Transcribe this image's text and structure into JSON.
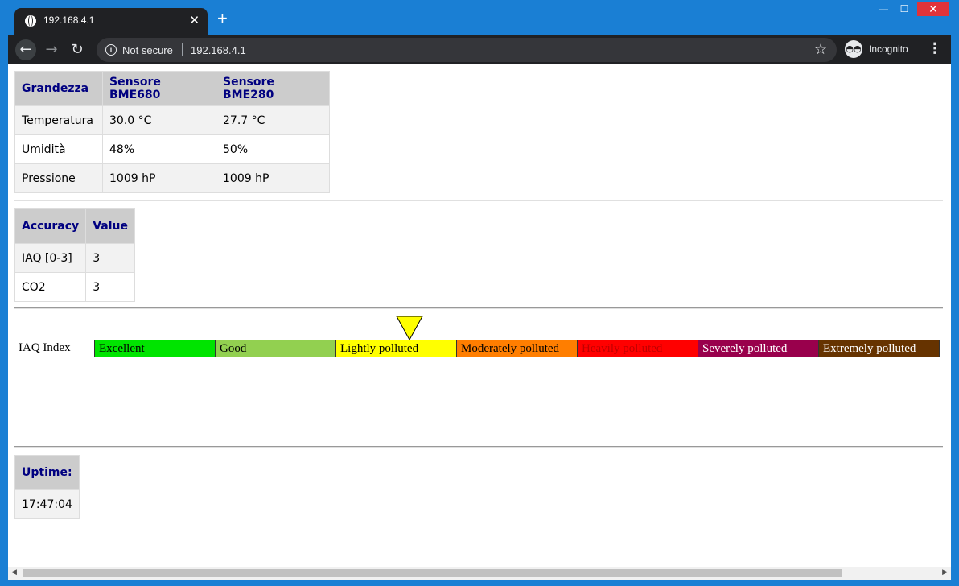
{
  "browser": {
    "tab_title": "192.168.4.1",
    "new_tab": "+",
    "security_label": "Not secure",
    "url": "192.168.4.1",
    "profile_label": "Incognito"
  },
  "sensors_table": {
    "headers": [
      "Grandezza",
      "Sensore BME680",
      "Sensore BME280"
    ],
    "rows": [
      [
        "Temperatura",
        "30.0 °C",
        "27.7 °C"
      ],
      [
        "Umidità",
        "48%",
        "50%"
      ],
      [
        "Pressione",
        "1009 hP",
        "1009 hP"
      ]
    ]
  },
  "accuracy_table": {
    "headers": [
      "Accuracy",
      "Value"
    ],
    "rows": [
      [
        "IAQ [0-3]",
        "3"
      ],
      [
        "CO2",
        "3"
      ]
    ]
  },
  "iaq": {
    "label": "IAQ Index",
    "current_level": "Lightly polluted",
    "scale": [
      {
        "label": "Excellent",
        "color": "#00e400",
        "text_color": "#000000"
      },
      {
        "label": "Good",
        "color": "#92d050",
        "text_color": "#000000"
      },
      {
        "label": "Lightly polluted",
        "color": "#ffff00",
        "text_color": "#000000"
      },
      {
        "label": "Moderately polluted",
        "color": "#ff7e00",
        "text_color": "#000000"
      },
      {
        "label": "Heavily polluted",
        "color": "#ff0000",
        "text_color": "#c00000"
      },
      {
        "label": "Severely polluted",
        "color": "#99004c",
        "text_color": "#ffffff"
      },
      {
        "label": "Extremely polluted",
        "color": "#663300",
        "text_color": "#ffffff"
      }
    ],
    "marker_color": "#ffff00"
  },
  "uptime": {
    "header": "Uptime:",
    "value": "17:47:04"
  }
}
